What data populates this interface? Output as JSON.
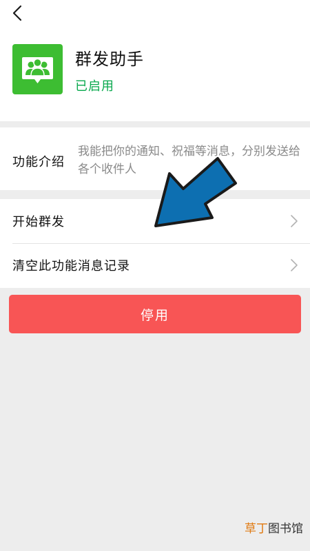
{
  "header": {
    "back_icon": "chevron-left-icon"
  },
  "app": {
    "icon": "group-users-icon",
    "icon_color": "#3dbd32",
    "title": "群发助手",
    "status": "已启用",
    "status_color": "#07a84c"
  },
  "intro": {
    "label": "功能介绍",
    "text": "我能把你的通知、祝福等消息，分别发送给各个收件人"
  },
  "menu": {
    "items": [
      {
        "label": "开始群发",
        "icon": "chevron-right-icon"
      },
      {
        "label": "清空此功能消息记录",
        "icon": "chevron-right-icon"
      }
    ]
  },
  "actions": {
    "disable_label": "停用",
    "disable_color": "#f85555"
  },
  "annotation": {
    "icon": "blue-pointer-arrow-icon",
    "color": "#0d6fb1"
  },
  "watermark": {
    "accent": "草丁",
    "rest": "图书馆"
  }
}
